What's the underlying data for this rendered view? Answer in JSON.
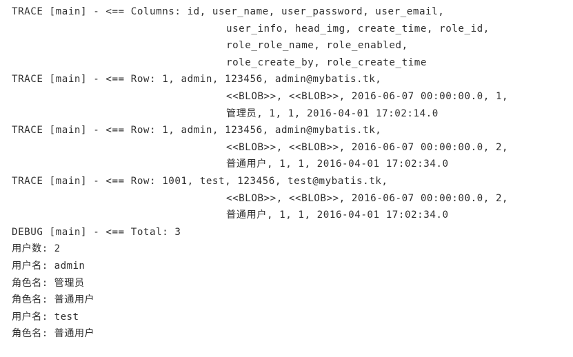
{
  "console": {
    "background_color": "#ffffff",
    "text_color": "#2f2f2f",
    "lines": [
      {
        "id": "columns-head",
        "indent": "none",
        "text": "TRACE [main] - <== Columns: id, user_name, user_password, user_email,"
      },
      {
        "id": "columns-c1",
        "indent": "cont",
        "text": "user_info, head_img, create_time, role_id,"
      },
      {
        "id": "columns-c2",
        "indent": "cont",
        "text": "role_role_name, role_enabled,"
      },
      {
        "id": "columns-c3",
        "indent": "cont",
        "text": "role_create_by, role_create_time"
      },
      {
        "id": "row1-head",
        "indent": "none",
        "text": "TRACE [main] - <== Row: 1, admin, 123456, admin@mybatis.tk,"
      },
      {
        "id": "row1-c1",
        "indent": "cont",
        "text": "<<BLOB>>, <<BLOB>>, 2016-06-07 00:00:00.0, 1,"
      },
      {
        "id": "row1-c2",
        "indent": "cont",
        "text": "管理员, 1, 1, 2016-04-01 17:02:14.0"
      },
      {
        "id": "row2-head",
        "indent": "none",
        "text": "TRACE [main] - <== Row: 1, admin, 123456, admin@mybatis.tk,"
      },
      {
        "id": "row2-c1",
        "indent": "cont",
        "text": "<<BLOB>>, <<BLOB>>, 2016-06-07 00:00:00.0, 2,"
      },
      {
        "id": "row2-c2",
        "indent": "cont",
        "text": "普通用户, 1, 1, 2016-04-01 17:02:34.0"
      },
      {
        "id": "row3-head",
        "indent": "none",
        "text": "TRACE [main] - <== Row: 1001, test, 123456, test@mybatis.tk,"
      },
      {
        "id": "row3-c1",
        "indent": "cont",
        "text": "<<BLOB>>, <<BLOB>>, 2016-06-07 00:00:00.0, 2,"
      },
      {
        "id": "row3-c2",
        "indent": "cont",
        "text": "普通用户, 1, 1, 2016-04-01 17:02:34.0"
      },
      {
        "id": "total",
        "indent": "none",
        "text": "DEBUG [main] - <== Total: 3"
      },
      {
        "id": "user-count",
        "indent": "none",
        "text": "用户数: 2"
      },
      {
        "id": "user-name-1",
        "indent": "none",
        "text": "用户名: admin"
      },
      {
        "id": "role-name-1",
        "indent": "none",
        "text": "角色名: 管理员"
      },
      {
        "id": "role-name-2",
        "indent": "none",
        "text": "角色名: 普通用户"
      },
      {
        "id": "user-name-2",
        "indent": "none",
        "text": "用户名: test"
      },
      {
        "id": "role-name-3",
        "indent": "none",
        "text": "角色名: 普通用户"
      }
    ]
  }
}
